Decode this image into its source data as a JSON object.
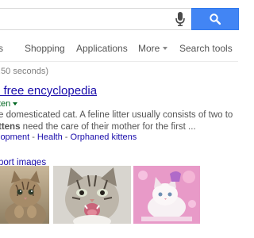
{
  "search": {
    "query": ""
  },
  "tabs": [
    {
      "label": "s"
    },
    {
      "label": "Shopping"
    },
    {
      "label": "Applications"
    },
    {
      "label": "More"
    },
    {
      "label": "Search tools"
    }
  ],
  "stats": {
    "text": ".50 seconds)"
  },
  "result": {
    "title": "e free encyclopedia",
    "url": "ten",
    "snippet_line1": "e domesticated cat. A feline litter usually consists of two to",
    "snippet_line2_bold": "ttens",
    "snippet_line2_rest": " need the care of their mother for the first ...",
    "sitelinks": [
      "lopment",
      "Health",
      "Orphaned kittens"
    ],
    "sitelink_separator": " - "
  },
  "images": {
    "report_label": "port images",
    "thumbnails": [
      {
        "icon": "kitten-photo",
        "alt": "tabby kitten"
      },
      {
        "icon": "kitten-photo",
        "alt": "meowing kitten"
      },
      {
        "icon": "kitten-photo",
        "alt": "white kitten on pink"
      }
    ]
  },
  "colors": {
    "accent": "#4285f4",
    "link": "#1a0dab",
    "url_green": "#006621",
    "snippet": "#545454",
    "pink_bg": "#e89ac8"
  }
}
